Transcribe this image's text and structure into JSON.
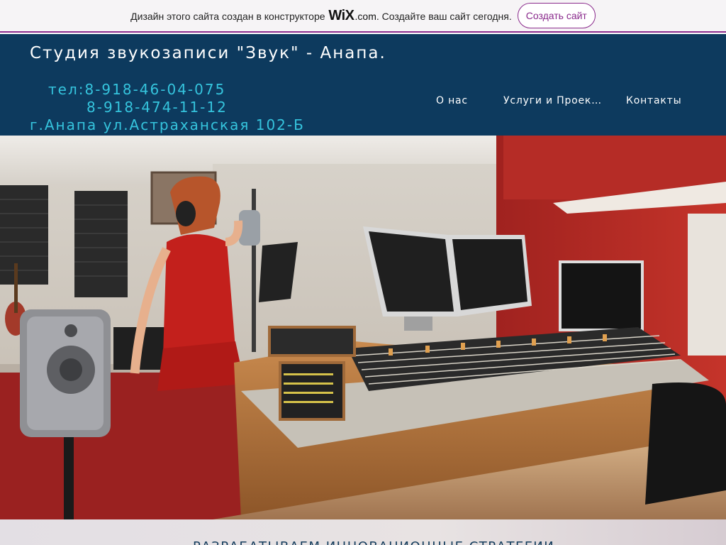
{
  "wix_banner": {
    "text_before": "Дизайн этого сайта создан в конструкторе ",
    "logo": "WiX",
    "logo_suffix": ".com",
    "text_after": ". Создайте ваш сайт сегодня.",
    "button_label": "Создать сайт"
  },
  "header": {
    "title": "Студия звукозаписи \"Звук\" - Анапа.",
    "phone1": "тел:8-918-46-04-075",
    "phone2": "8-918-474-11-12",
    "address": "г.Анапа ул.Астраханская 102-Б"
  },
  "nav": {
    "items": [
      {
        "label": "О нас"
      },
      {
        "label": "Услуги и Проекты"
      },
      {
        "label": "Контакты"
      }
    ]
  },
  "hero": {
    "image": "recording-studio-photo"
  },
  "section": {
    "heading_partial": "РАЗРАБАТЫВАЕМ ИННОВАЦИОННЫЕ СТРАТЕГИИ"
  },
  "colors": {
    "header_bg": "#0d3a5e",
    "contact_text": "#35c4dd",
    "wix_accent": "#8a2a8c"
  }
}
